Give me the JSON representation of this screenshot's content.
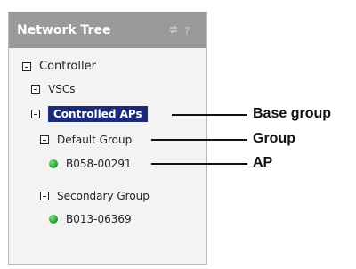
{
  "panel": {
    "title": "Network Tree",
    "header_icons": [
      "refresh-icon",
      "help-icon"
    ],
    "help_glyph": "?"
  },
  "tree": {
    "controller": "Controller",
    "vscs": "VSCs",
    "controlled_aps": "Controlled APs",
    "default_group": "Default Group",
    "ap1": "B058-00291",
    "secondary_group": "Secondary Group",
    "ap2": "B013-06369"
  },
  "callouts": {
    "base_group": "Base group",
    "group": "Group",
    "ap": "AP"
  },
  "colors": {
    "header_bg": "#9a9a9a",
    "selected_bg": "#1c2a7a",
    "status_green": "#2aa82f"
  }
}
